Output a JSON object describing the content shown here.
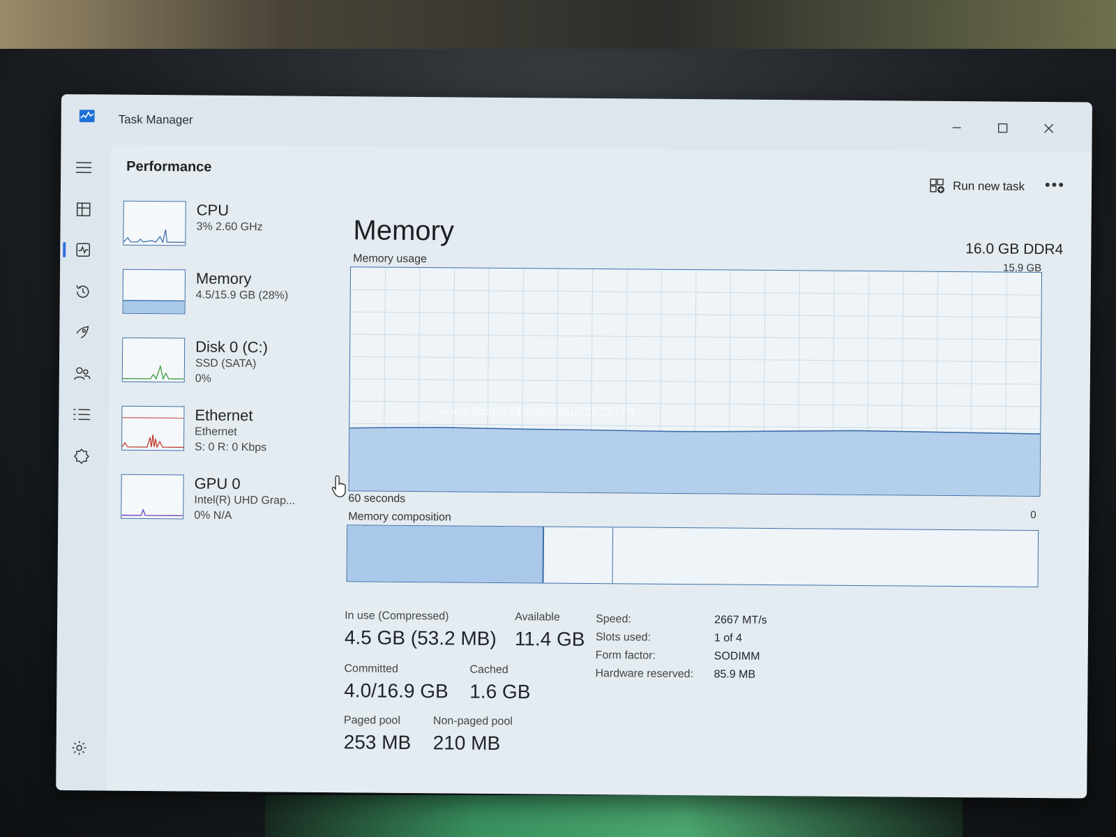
{
  "window": {
    "title": "Task Manager"
  },
  "header": {
    "page_title": "Performance",
    "run_task_label": "Run new task",
    "more_label": "•••"
  },
  "devices": [
    {
      "name": "CPU",
      "line1": "3% 2.60 GHz",
      "line2": ""
    },
    {
      "name": "Memory",
      "line1": "4.5/15.9 GB (28%)",
      "line2": ""
    },
    {
      "name": "Disk 0 (C:)",
      "line1": "SSD (SATA)",
      "line2": "0%"
    },
    {
      "name": "Ethernet",
      "line1": "Ethernet",
      "line2": "S: 0 R: 0 Kbps"
    },
    {
      "name": "GPU 0",
      "line1": "Intel(R) UHD Grap...",
      "line2": "0% N/A"
    }
  ],
  "memory": {
    "title": "Memory",
    "spec": "16.0 GB DDR4",
    "usage_label": "Memory usage",
    "max_label": "15.9 GB",
    "time_label": "60 seconds",
    "zero_label": "0",
    "composition_label": "Memory composition",
    "usage_fraction": 0.28,
    "composition": {
      "in_use_gb": 4.5,
      "cached_gb": 1.6,
      "total_gb": 15.9
    }
  },
  "stats": {
    "in_use_label": "In use (Compressed)",
    "in_use_value": "4.5 GB (53.2 MB)",
    "available_label": "Available",
    "available_value": "11.4 GB",
    "committed_label": "Committed",
    "committed_value": "4.0/16.9 GB",
    "cached_label": "Cached",
    "cached_value": "1.6 GB",
    "paged_label": "Paged pool",
    "paged_value": "253 MB",
    "nonpaged_label": "Non-paged pool",
    "nonpaged_value": "210 MB"
  },
  "specs": {
    "speed_key": "Speed:",
    "speed_val": "2667 MT/s",
    "slots_key": "Slots used:",
    "slots_val": "1 of 4",
    "form_key": "Form factor:",
    "form_val": "SODIMM",
    "hw_key": "Hardware reserved:",
    "hw_val": "85.9 MB"
  },
  "watermark": "www.khmer24.com/rthn72622378",
  "colors": {
    "accent": "#2f6fdc",
    "graph_line": "#3d6ea8",
    "graph_fill": "#a9c8ea",
    "ethernet_line": "#c0392b",
    "disk_line": "#3a9a3a",
    "gpu_line": "#6b3fbf"
  }
}
